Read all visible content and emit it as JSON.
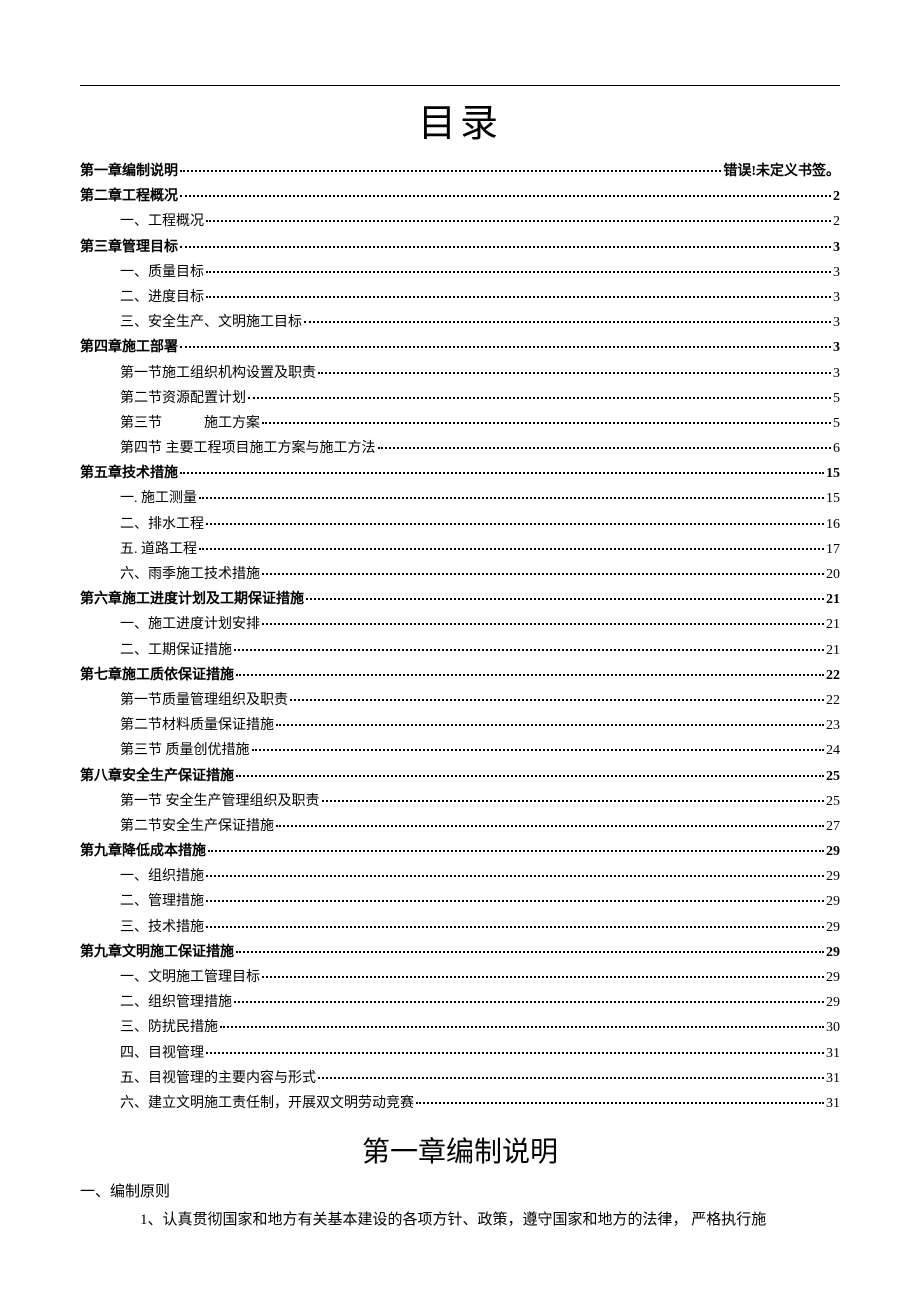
{
  "title": "目录",
  "toc": [
    {
      "level": 1,
      "label": "第一章编制说明",
      "page": "错误!未定义书签。"
    },
    {
      "level": 1,
      "label": "第二章工程概况",
      "page": "2"
    },
    {
      "level": 2,
      "label": "一、工程概况",
      "page": "2"
    },
    {
      "level": 1,
      "label": "第三章管理目标",
      "page": "3"
    },
    {
      "level": 2,
      "label": "一、质量目标",
      "page": "3"
    },
    {
      "level": 2,
      "label": "二、进度目标",
      "page": "3"
    },
    {
      "level": 2,
      "label": "三、安全生产、文明施工目标",
      "page": "3"
    },
    {
      "level": 1,
      "label": "第四章施工部署",
      "page": "3"
    },
    {
      "level": 2,
      "label": "第一节施工组织机构设置及职责",
      "page": "3"
    },
    {
      "level": 2,
      "label": "第二节资源配置计划",
      "page": "5"
    },
    {
      "level": 2,
      "label": "第三节　　　施工方案",
      "page": "5"
    },
    {
      "level": 2,
      "label": "第四节 主要工程项目施工方案与施工方法",
      "page": "6"
    },
    {
      "level": 1,
      "label": "第五章技术措施",
      "page": "15"
    },
    {
      "level": 2,
      "label": "一. 施工测量",
      "page": "15"
    },
    {
      "level": 2,
      "label": "二、排水工程",
      "page": "16"
    },
    {
      "level": 2,
      "label": "五. 道路工程",
      "page": "17"
    },
    {
      "level": 2,
      "label": "六、雨季施工技术措施",
      "page": "20"
    },
    {
      "level": 1,
      "label": "第六章施工进度计划及工期保证措施",
      "page": "21"
    },
    {
      "level": 2,
      "label": "一、施工进度计划安排",
      "page": "21"
    },
    {
      "level": 2,
      "label": "二、工期保证措施",
      "page": "21"
    },
    {
      "level": 1,
      "label": "第七章施工质依保证措施",
      "page": "22"
    },
    {
      "level": 2,
      "label": "第一节质量管理组织及职责",
      "page": "22"
    },
    {
      "level": 2,
      "label": "第二节材料质量保证措施",
      "page": "23"
    },
    {
      "level": 2,
      "label": "第三节 质量创优措施",
      "page": "24"
    },
    {
      "level": 1,
      "label": "第八章安全生产保证措施",
      "page": "25"
    },
    {
      "level": 2,
      "label": "第一节 安全生产管理组织及职责",
      "page": "25"
    },
    {
      "level": 2,
      "label": "第二节安全生产保证措施",
      "page": "27"
    },
    {
      "level": 1,
      "label": "第九章降低成本措施",
      "page": "29"
    },
    {
      "level": 2,
      "label": "一、组织措施",
      "page": "29"
    },
    {
      "level": 2,
      "label": "二、管理措施",
      "page": "29"
    },
    {
      "level": 2,
      "label": "三、技术措施",
      "page": "29"
    },
    {
      "level": 1,
      "label": "第九章文明施工保证措施",
      "page": "29"
    },
    {
      "level": 2,
      "label": "一、文明施工管理目标",
      "page": "29"
    },
    {
      "level": 2,
      "label": "二、组织管理措施",
      "page": "29"
    },
    {
      "level": 2,
      "label": "三、防扰民措施",
      "page": "30"
    },
    {
      "level": 2,
      "label": "四、目视管理",
      "page": "31"
    },
    {
      "level": 2,
      "label": "五、目视管理的主要内容与形式",
      "page": "31"
    },
    {
      "level": 2,
      "label": "六、建立文明施工责任制，开展双文明劳动竞赛",
      "page": "31"
    }
  ],
  "chapter_heading": "第一章编制说明",
  "section_heading": "一、编制原则",
  "body_paragraph": "1、认真贯彻国家和地方有关基本建设的各项方针、政策，遵守国家和地方的法律， 严格执行施"
}
